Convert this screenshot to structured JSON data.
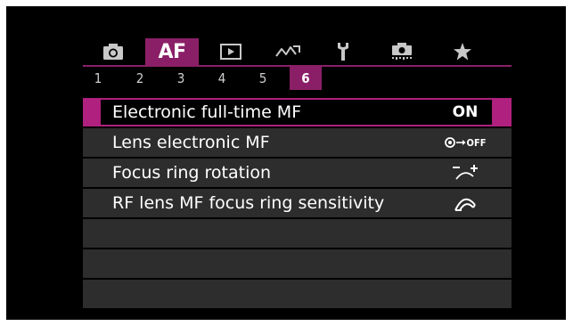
{
  "tabs": [
    {
      "icon": "camera-icon",
      "label": ""
    },
    {
      "icon": "",
      "label": "AF"
    },
    {
      "icon": "playback-icon",
      "label": ""
    },
    {
      "icon": "wireless-icon",
      "label": ""
    },
    {
      "icon": "wrench-icon",
      "label": ""
    },
    {
      "icon": "custom-camera-icon",
      "label": ""
    },
    {
      "icon": "star-icon",
      "label": ""
    }
  ],
  "active_tab": "AF",
  "pages": [
    "1",
    "2",
    "3",
    "4",
    "5",
    "6"
  ],
  "active_page": "6",
  "menu_items": [
    {
      "label": "Electronic full-time MF",
      "value": "ON",
      "selected": true
    },
    {
      "label": "Lens electronic MF",
      "value": "OFF",
      "value_icon": "lens-mf-off-icon"
    },
    {
      "label": "Focus ring rotation",
      "value": "",
      "value_icon": "focus-ring-rotation-icon"
    },
    {
      "label": "RF lens MF focus ring sensitivity",
      "value": "",
      "value_icon": "ring-sensitivity-icon"
    }
  ],
  "colors": {
    "accent": "#8a1f67",
    "selected_marker": "#b0207e",
    "row_bg": "#2d2d2d",
    "screen_bg": "#000000"
  }
}
